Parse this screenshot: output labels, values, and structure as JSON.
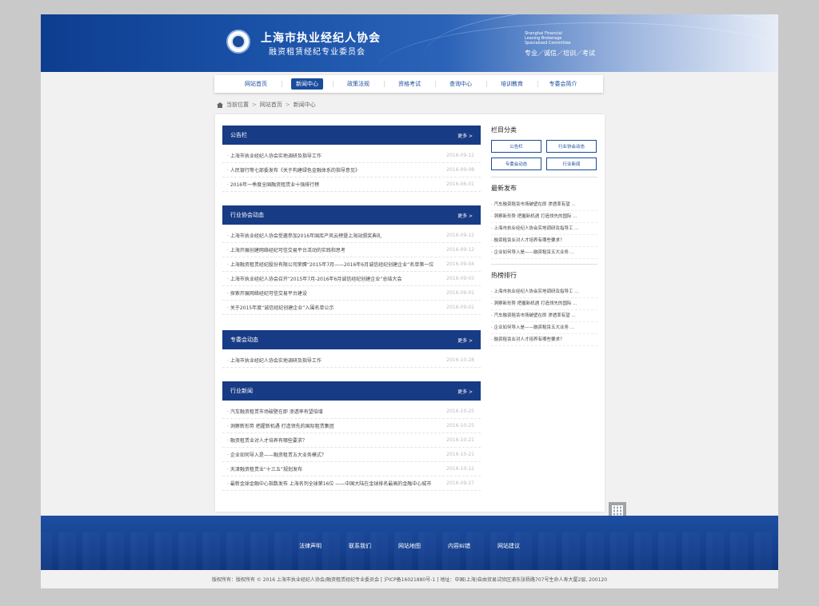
{
  "header": {
    "title_cn": "上海市执业经纪人协会",
    "subtitle_cn": "融资租赁经纪专业委员会",
    "title_en_1": "Shanghai Financial",
    "title_en_2": "Leasing Brokerage",
    "title_en_3": "Specialized Committee",
    "slogan": "专业／诚信／培训／考试"
  },
  "nav": [
    "网站首页",
    "新闻中心",
    "政策法规",
    "资格考试",
    "查询中心",
    "培训教育",
    "专委会简介"
  ],
  "nav_active_index": 1,
  "breadcrumb": {
    "label": "当前位置",
    "home": "网站首页",
    "current": "新闻中心",
    "sep": ">"
  },
  "more_label": "更多 >",
  "panels": [
    {
      "title": "公告栏",
      "items": [
        {
          "title": "上海市执业经纪人协会实地调研及指导工作",
          "date": "2016-09-12"
        },
        {
          "title": "人民银行等七部委发布《关于构建绿色金融体系的指导意见》",
          "date": "2016-09-08"
        },
        {
          "title": "2016年一季度全国融资租赁业十强排行榜",
          "date": "2016-06-01"
        }
      ]
    },
    {
      "title": "行业协会动态",
      "items": [
        {
          "title": "上海市执业经纪人协会受邀参加2016年国库产风云榜暨上海站颁奖典礼",
          "date": "2016-09-12"
        },
        {
          "title": "上海开展创建网络经纪可信交易平台活动的实践和思考",
          "date": "2016-09-12"
        },
        {
          "title": "上海融资租赁经纪股份有限公司荣膺“2015年7月——2016年6月诚信经纪创建企业”名单第一位",
          "date": "2016-09-04"
        },
        {
          "title": "上海市执业经纪人协会召开“2015年7月-2016年6月诚信经纪创建企业”总结大会",
          "date": "2016-09-03"
        },
        {
          "title": "探索开展网络经纪可信交易平台建设",
          "date": "2016-09-01"
        },
        {
          "title": "关于2015年度“诚信经纪创建企业”入围名单公示",
          "date": "2016-09-01"
        }
      ]
    },
    {
      "title": "专委会动态",
      "items": [
        {
          "title": "上海市执业经纪人协会实地调研及指导工作",
          "date": "2016-10-28"
        }
      ]
    },
    {
      "title": "行业新闻",
      "items": [
        {
          "title": "汽车融资租赁市场破壁在即 渗透率有望倍增",
          "date": "2016-10-25"
        },
        {
          "title": "洞察新形势 把握新机遇 打造领先的国际租赁集团",
          "date": "2016-10-25"
        },
        {
          "title": "融资租赁业对人才培养有哪些要求？",
          "date": "2016-10-21"
        },
        {
          "title": "企业如何导入是——融资租赁五大业务模式？",
          "date": "2016-10-21"
        },
        {
          "title": "天津融资租赁业“十三五”规划发布",
          "date": "2016-10-12"
        },
        {
          "title": "最新金球金融中心指数发布 上海名列全球第16位 ——中国大陆在金球排名最高的金融中心城市",
          "date": "2016-09-27"
        }
      ]
    }
  ],
  "sidebar": {
    "categories_title": "栏目分类",
    "categories": [
      "公告栏",
      "行业协会动态",
      "专委会动态",
      "行业新闻"
    ],
    "latest_title": "最新发布",
    "latest": [
      "汽车融资租赁市场破壁在即 渗透率有望 ...",
      "洞察新形势 把握新机遇 打造领先的国际 ...",
      "上海市执业经纪人协会实地调研及指导工 ...",
      "融资租赁业对人才培养有哪些要求？",
      "企业如何导入是——融资租赁五大业务 ..."
    ],
    "hot_title": "热榜排行",
    "hot": [
      "上海市执业经纪人协会实地调研及指导工 ...",
      "洞察新形势 把握新机遇 打造领先的国际 ...",
      "汽车融资租赁市场破壁在即 渗透率有望 ...",
      "企业如何导入是——融资租赁五大业务 ...",
      "融资租赁业对人才培养有哪些要求？"
    ]
  },
  "footer": {
    "links": [
      "法律声明",
      "联系我们",
      "网站地图",
      "内容纠错",
      "网站建议"
    ],
    "copyright": "版权所有：版权所有 © 2016 上海市执业经纪人协会/融资租赁经纪专业委员会 [ 沪ICP备16021880号-1 ]      地址：中国(上海)自由贸易试验区浦东张杨路707号生命人寿大厦2层, 200120"
  },
  "colors": {
    "primary": "#183b85",
    "accent": "#1a4c9c"
  }
}
